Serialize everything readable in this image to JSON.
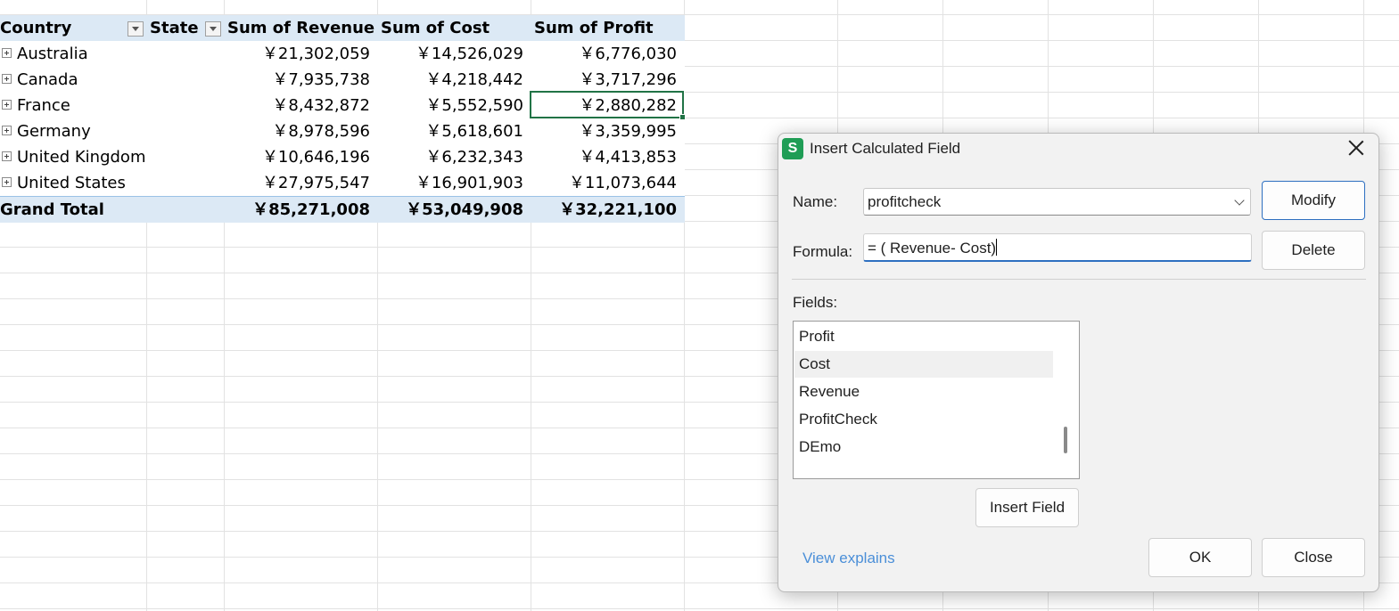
{
  "pivot": {
    "headers": {
      "country": "Country",
      "state": "State",
      "revenue": "Sum of Revenue",
      "cost": "Sum of Cost",
      "profit": "Sum of Profit"
    },
    "rows": [
      {
        "country": "Australia",
        "revenue": "￥21,302,059",
        "cost": "￥14,526,029",
        "profit": "￥6,776,030"
      },
      {
        "country": "Canada",
        "revenue": "￥7,935,738",
        "cost": "￥4,218,442",
        "profit": "￥3,717,296"
      },
      {
        "country": "France",
        "revenue": "￥8,432,872",
        "cost": "￥5,552,590",
        "profit": "￥2,880,282"
      },
      {
        "country": "Germany",
        "revenue": "￥8,978,596",
        "cost": "￥5,618,601",
        "profit": "￥3,359,995"
      },
      {
        "country": "United Kingdom",
        "revenue": "￥10,646,196",
        "cost": "￥6,232,343",
        "profit": "￥4,413,853"
      },
      {
        "country": "United States",
        "revenue": "￥27,975,547",
        "cost": "￥16,901,903",
        "profit": "￥11,073,644"
      }
    ],
    "total": {
      "label": "Grand Total",
      "revenue": "￥85,271,008",
      "cost": "￥53,049,908",
      "profit": "￥32,221,100"
    }
  },
  "dialog": {
    "app_icon": "S",
    "title": "Insert Calculated Field",
    "name_label": "Name:",
    "name_value": "profitcheck",
    "formula_label": "Formula:",
    "formula_value": "= ( Revenue- Cost)",
    "fields_label": "Fields:",
    "fields": [
      "Profit",
      "Cost",
      "Revenue",
      "ProfitCheck",
      "DEmo"
    ],
    "selected_field": "Cost",
    "buttons": {
      "modify": "Modify",
      "delete": "Delete",
      "insert_field": "Insert Field",
      "ok": "OK",
      "close": "Close"
    },
    "link": "View explains"
  },
  "colors": {
    "pivot_header_bg": "#dce9f5",
    "selection_border": "#217346",
    "app_icon": "#1f9d55",
    "link": "#4b8fd8",
    "focus_border": "#2d6fc0"
  }
}
